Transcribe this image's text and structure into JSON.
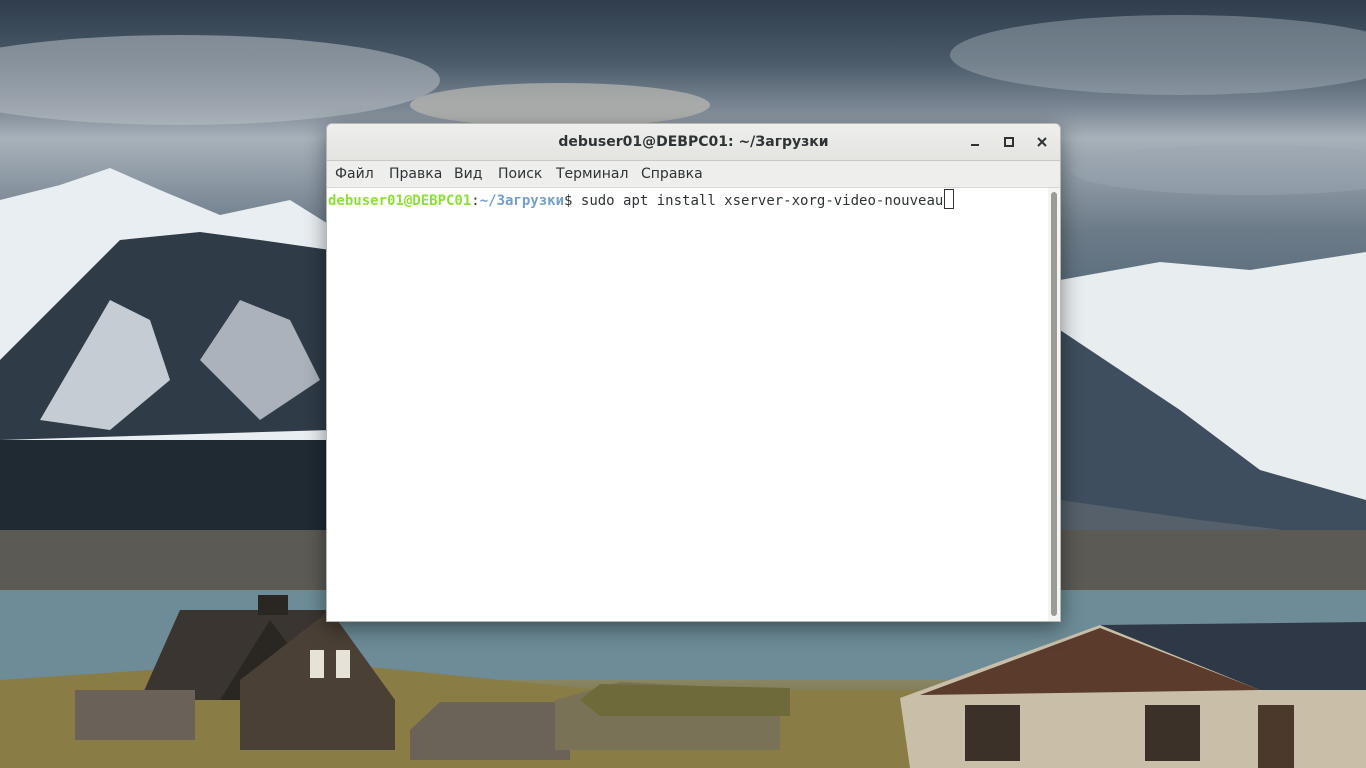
{
  "window": {
    "title": "debuser01@DEBPC01: ~/Загрузки",
    "controls": {
      "minimize_icon": "minimize-icon",
      "maximize_icon": "maximize-icon",
      "close_icon": "close-icon"
    }
  },
  "menu": {
    "items": [
      {
        "label": "Файл"
      },
      {
        "label": "Правка"
      },
      {
        "label": "Вид"
      },
      {
        "label": "Поиск"
      },
      {
        "label": "Терминал"
      },
      {
        "label": "Справка"
      }
    ]
  },
  "terminal": {
    "prompt_user_host": "debuser01@DEBPC01",
    "prompt_sep": ":",
    "prompt_path": "~/Загрузки",
    "prompt_symbol": "$ ",
    "command": "sudo apt install xserver-xorg-video-nouveau"
  },
  "colors": {
    "prompt_user": "#8ae234",
    "prompt_path": "#729fcf",
    "text": "#2e3436",
    "background": "#ffffff"
  }
}
